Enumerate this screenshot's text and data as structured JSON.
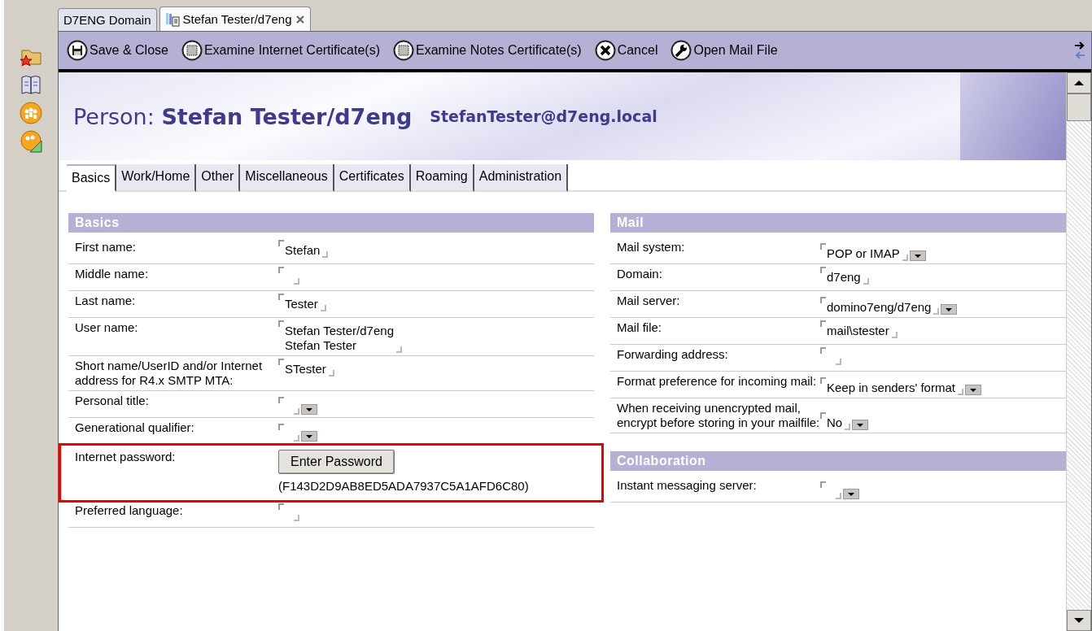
{
  "window_tabs": [
    {
      "label": "D7ENG Domain",
      "selected": false
    },
    {
      "label": "Stefan Tester/d7eng",
      "selected": true
    }
  ],
  "sidebar": {
    "icons": [
      {
        "kind": "folder"
      },
      {
        "kind": "book"
      },
      {
        "kind": "people"
      },
      {
        "kind": "tools"
      }
    ]
  },
  "toolbar": {
    "buttons": [
      {
        "label": "Save & Close",
        "kind": "save"
      },
      {
        "label": "Examine Internet Certificate(s)",
        "kind": "certificate"
      },
      {
        "label": "Examine Notes Certificate(s)",
        "kind": "certificate"
      },
      {
        "label": "Cancel",
        "kind": "cancel"
      },
      {
        "label": "Open Mail File",
        "kind": "wrench"
      }
    ]
  },
  "header": {
    "title": "Person: **Stefan Tester/d7eng**",
    "email": "StefanTester@d7eng.local"
  },
  "form_tabs": [
    {
      "label": "Basics",
      "selected": true
    },
    {
      "label": "Work/Home",
      "selected": false
    },
    {
      "label": "Other",
      "selected": false
    },
    {
      "label": "Miscellaneous",
      "selected": false
    },
    {
      "label": "Certificates",
      "selected": false
    },
    {
      "label": "Roaming",
      "selected": false
    },
    {
      "label": "Administration",
      "selected": false
    }
  ],
  "left_sections": [
    {
      "title": "Basics",
      "fields": [
        {
          "label": "First name:",
          "kind": "text",
          "lines": [
            "Stefan"
          ]
        },
        {
          "label": "Middle name:",
          "kind": "text"
        },
        {
          "label": "Last name:",
          "kind": "text",
          "lines": [
            "Tester"
          ]
        },
        {
          "label": "User name:",
          "kind": "text",
          "lines": [
            "Stefan Tester/d7eng",
            "Stefan Tester"
          ]
        },
        {
          "label": "Short name/UserID and/or Internet address for R4.x SMTP MTA:",
          "kind": "text",
          "lines": [
            "STester"
          ]
        },
        {
          "label": "Personal title:",
          "kind": "dropdown"
        },
        {
          "label": "Generational qualifier:",
          "kind": "dropdown"
        },
        {
          "label": "Internet password:",
          "kind": "password",
          "button": "Enter Password",
          "hash": "(F143D2D9AB8ED5ADA7937C5A1AFD6C80)",
          "highlighted": true
        },
        {
          "label": "Preferred language:",
          "kind": "text"
        }
      ]
    }
  ],
  "right_sections": [
    {
      "title": "Mail",
      "fields": [
        {
          "label": "Mail system:",
          "kind": "dropdown",
          "lines": [
            "POP or IMAP"
          ]
        },
        {
          "label": "Domain:",
          "kind": "text",
          "lines": [
            "d7eng"
          ]
        },
        {
          "label": "Mail server:",
          "kind": "dropdown",
          "lines": [
            "domino7eng/d7eng"
          ]
        },
        {
          "label": "Mail file:",
          "kind": "text",
          "lines": [
            "mail\\stester"
          ]
        },
        {
          "label": "Forwarding address:",
          "kind": "text"
        },
        {
          "label": "Format preference for incoming mail:",
          "kind": "dropdown",
          "lines": [
            "Keep in senders' format"
          ]
        },
        {
          "label": "When receiving unencrypted mail, encrypt before storing in your mailfile:",
          "kind": "dropdown",
          "lines": [
            "No"
          ]
        }
      ]
    },
    {
      "title": "Collaboration",
      "fields": [
        {
          "label": "Instant messaging server:",
          "kind": "dropdown"
        }
      ]
    }
  ]
}
